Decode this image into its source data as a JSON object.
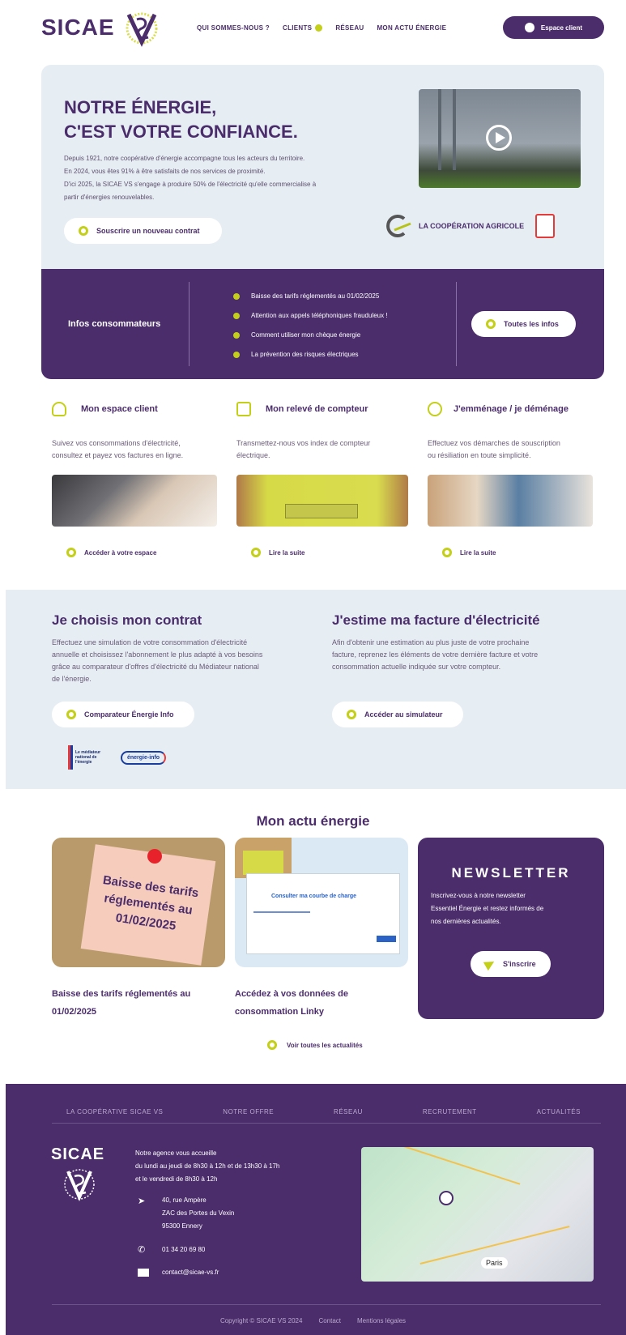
{
  "header": {
    "logo": "SICAE",
    "nav": [
      "QUI SOMMES-NOUS ?",
      "CLIENTS",
      "RÉSEAU",
      "MON ACTU ÉNERGIE"
    ],
    "client_button": "Espace client"
  },
  "hero": {
    "title_line1": "NOTRE ÉNERGIE,",
    "title_line2": "C'EST VOTRE CONFIANCE.",
    "text_line1": "Depuis 1921, notre coopérative d'énergie accompagne tous les acteurs du territoire.",
    "text_line2": "En 2024, vous êtes 91% à être satisfaits de nos services de proximité.",
    "text_line3": "D'ici 2025, la SICAE VS s'engage à produire 50% de l'électricité qu'elle commercialise à",
    "text_line4": "partir d'énergies renouvelables.",
    "cta": "Souscrire un nouveau contrat",
    "partner": "LA COOPÉRATION AGRICOLE"
  },
  "infos": {
    "label": "Infos consommateurs",
    "items": [
      "Baisse des tarifs réglementés au 01/02/2025",
      "Attention aux appels téléphoniques frauduleux !",
      "Comment utiliser mon chèque énergie",
      "La prévention des risques électriques"
    ],
    "button": "Toutes les infos"
  },
  "cards": [
    {
      "title": "Mon espace client",
      "text1": "Suivez vos consommations d'électricité,",
      "text2": "consultez et payez vos factures en ligne.",
      "link": "Accéder à votre espace"
    },
    {
      "title": "Mon relevé de compteur",
      "text1": "Transmettez-nous vos index de compteur",
      "text2": "électrique.",
      "link": "Lire la suite"
    },
    {
      "title": "J'emménage / je déménage",
      "text1": "Effectuez vos démarches de souscription",
      "text2": "ou résiliation en toute simplicité.",
      "link": "Lire la suite"
    }
  ],
  "contract": {
    "title": "Je choisis mon contrat",
    "lines": [
      "Effectuez une simulation de votre consommation d'électricité",
      "annuelle et choisissez l'abonnement le plus adapté à vos besoins",
      "grâce au comparateur d'offres d'électricité du Médiateur national",
      "de l'énergie."
    ],
    "button": "Comparateur Énergie Info",
    "logo1": "Le médiateur national de l'énergie",
    "logo2": "énergie-info"
  },
  "estimate": {
    "title": "J'estime ma facture d'électricité",
    "lines": [
      "Afin d'obtenir une estimation au plus juste de votre prochaine",
      "facture, reprenez les éléments de votre dernière facture et votre",
      "consommation actuelle indiquée sur votre compteur."
    ],
    "button": "Accéder au simulateur"
  },
  "news": {
    "heading": "Mon actu énergie",
    "note_text": [
      "Baisse des tarifs",
      "réglementés au",
      "01/02/2025"
    ],
    "screen_text": "Consulter ma courbe de charge",
    "item1_l1": "Baisse des tarifs réglementés au",
    "item1_l2": "01/02/2025",
    "item2_l1": "Accédez à vos données de",
    "item2_l2": "consommation Linky",
    "all_link": "Voir toutes les actualités"
  },
  "newsletter": {
    "title": "NEWSLETTER",
    "lines": [
      "Inscrivez-vous à notre newsletter",
      "Essentiel Énergie et restez informés de",
      "nos dernières actualités."
    ],
    "button": "S'inscrire"
  },
  "footer": {
    "nav": [
      "LA COOPÉRATIVE SICAE VS",
      "NOTRE OFFRE",
      "RÉSEAU",
      "RECRUTEMENT",
      "ACTUALITÉS"
    ],
    "logo": "SICAE",
    "hours": [
      "Notre agence vous accueille",
      "du lundi au jeudi de 8h30 à 12h et de 13h30 à 17h",
      "et le vendredi de 8h30 à 12h"
    ],
    "address": [
      "40, rue Ampère",
      "ZAC des Portes du Vexin",
      "95300 Ennery"
    ],
    "phone": "01 34 20 69 80",
    "email": "contact@sicae-vs.fr",
    "map_label": "Paris",
    "copyright": "Copyright © SICAE VS 2024",
    "contact": "Contact",
    "legal": "Mentions légales"
  }
}
